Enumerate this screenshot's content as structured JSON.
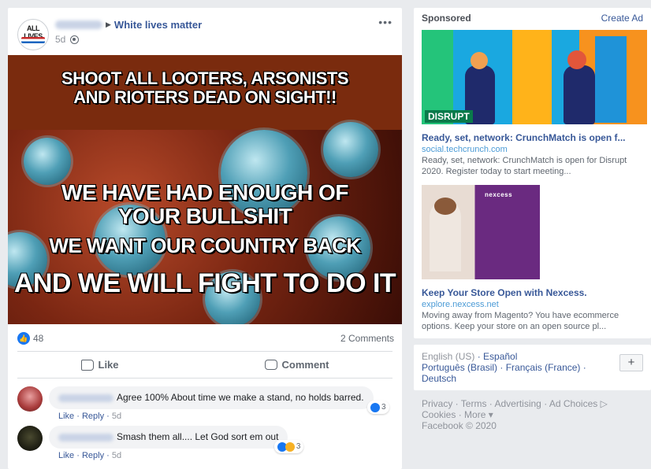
{
  "post": {
    "group_arrow": "▶",
    "group_name": "White lives matter",
    "time": "5d",
    "more": "•••",
    "avatar_text": "ALL LIVES",
    "meme": {
      "line1": "SHOOT ALL LOOTERS, ARSONISTS AND RIOTERS DEAD ON SIGHT!!",
      "line2": "WE HAVE HAD ENOUGH OF YOUR BULLSHIT",
      "line3": "WE WANT OUR COUNTRY BACK",
      "line4": "AND WE WILL FIGHT TO DO IT"
    },
    "like_count": "48",
    "comments_count": "2 Comments",
    "like_label": "Like",
    "comment_label": "Comment"
  },
  "comments": [
    {
      "text": "Agree 100% About time we make a stand, no holds barred.",
      "like": "Like",
      "reply": "Reply",
      "time": "5d",
      "reactions": "3"
    },
    {
      "text": "Smash them all.... Let God sort em out",
      "like": "Like",
      "reply": "Reply",
      "time": "5d",
      "reactions": "3"
    }
  ],
  "rail": {
    "sponsored": "Sponsored",
    "create_ad": "Create Ad",
    "ads": [
      {
        "title": "Ready, set, network: CrunchMatch is open f...",
        "domain": "social.techcrunch.com",
        "desc": "Ready, set, network: CrunchMatch is open for Disrupt 2020. Register today to start meeting...",
        "badge": "DISRUPT"
      },
      {
        "title": "Keep Your Store Open with Nexcess.",
        "domain": "explore.nexcess.net",
        "desc": "Moving away from Magento? You have ecommerce options. Keep your store on an open source pl...",
        "logo": "nexcess"
      }
    ],
    "languages": {
      "current": "English (US)",
      "links": [
        "Español",
        "Português (Brasil)",
        "Français (France)",
        "Deutsch"
      ],
      "plus": "+"
    },
    "footer": {
      "links": [
        "Privacy",
        "Terms",
        "Advertising",
        "Ad Choices ▷",
        "Cookies",
        "More"
      ],
      "copyright": "Facebook © 2020"
    }
  }
}
